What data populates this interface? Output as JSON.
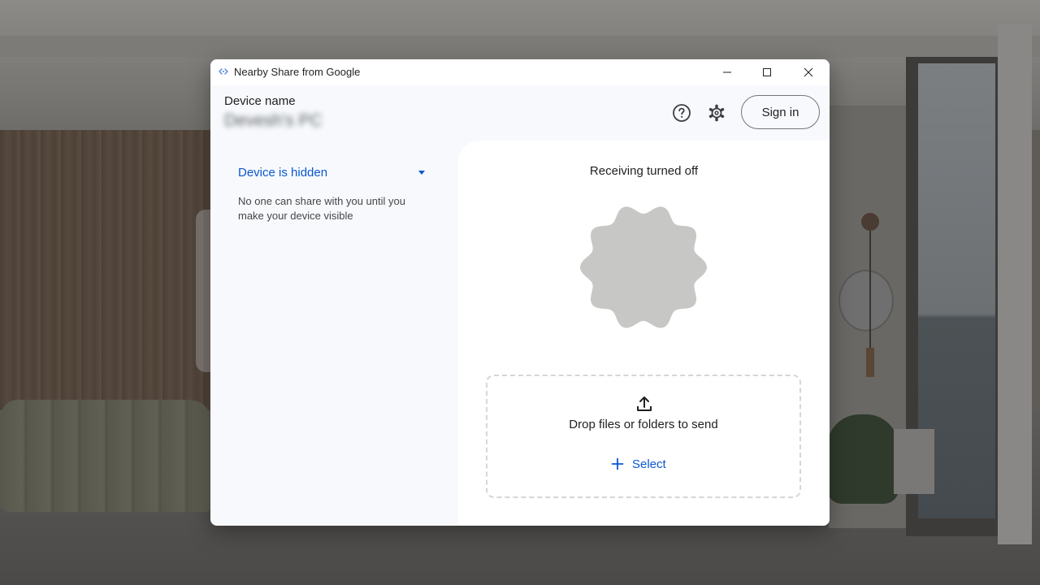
{
  "window": {
    "title": "Nearby Share from Google"
  },
  "header": {
    "device_label": "Device name",
    "device_name": "Devesh's PC",
    "sign_in_label": "Sign in"
  },
  "sidebar": {
    "visibility_label": "Device is hidden",
    "visibility_description": "No one can share with you until you make your device visible"
  },
  "main": {
    "receiving_status": "Receiving turned off",
    "dropzone_text": "Drop files or folders to send",
    "select_label": "Select"
  },
  "icons": {
    "app": "nearby-share-icon",
    "minimize": "minimize-icon",
    "maximize": "maximize-icon",
    "close": "close-icon",
    "help": "help-icon",
    "settings": "gear-icon",
    "dropdown": "dropdown-arrow-icon",
    "status": "status-scallop-shape",
    "upload": "upload-icon",
    "plus": "plus-icon"
  },
  "colors": {
    "accent": "#0b57d0",
    "window_bg": "#f7f9fc",
    "panel_bg": "#ffffff",
    "status_shape": "#c7c7c5",
    "text_primary": "#1f1f1f",
    "text_secondary": "#444746"
  }
}
